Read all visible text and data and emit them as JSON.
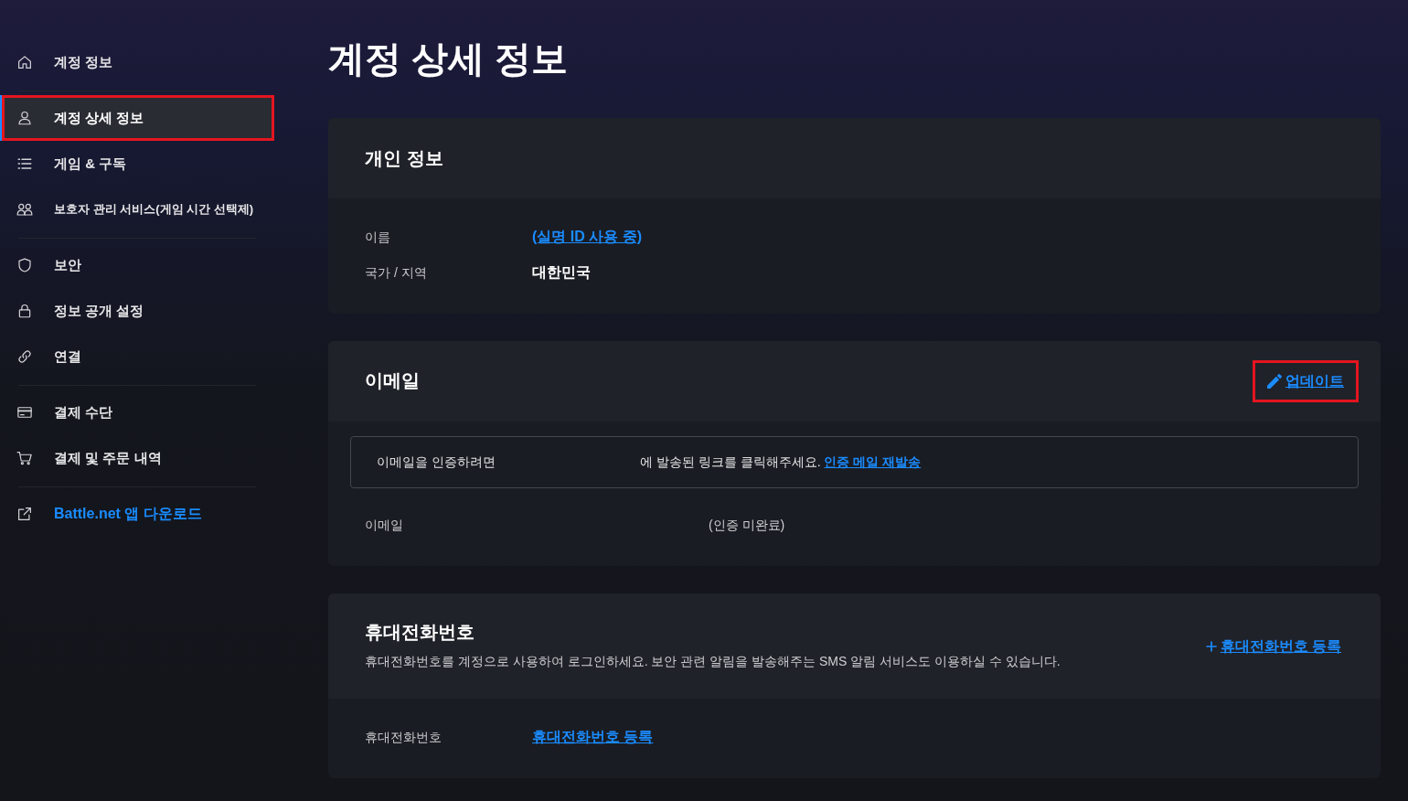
{
  "sidebar": {
    "groups": [
      {
        "items": [
          {
            "label": "계정 정보",
            "kind": "page",
            "selected": false,
            "highlighted": false
          }
        ]
      },
      {
        "items": [
          {
            "label": "계정 상세 정보",
            "kind": "page",
            "selected": true,
            "highlighted": true
          },
          {
            "label": "게임 & 구독",
            "kind": "page",
            "selected": false,
            "highlighted": false
          },
          {
            "label": "보호자 관리 서비스(게임 시간 선택제)",
            "kind": "compact",
            "selected": false,
            "highlighted": false
          }
        ]
      },
      {
        "items": [
          {
            "label": "보안",
            "kind": "page",
            "selected": false,
            "highlighted": false
          },
          {
            "label": "정보 공개 설정",
            "kind": "page",
            "selected": false,
            "highlighted": false
          },
          {
            "label": "연결",
            "kind": "page",
            "selected": false,
            "highlighted": false
          }
        ]
      },
      {
        "items": [
          {
            "label": "결제 수단",
            "kind": "page",
            "selected": false,
            "highlighted": false
          },
          {
            "label": "결제 및 주문 내역",
            "kind": "page",
            "selected": false,
            "highlighted": false
          }
        ]
      },
      {
        "items": [
          {
            "label": "Battle.net 앱 다운로드",
            "kind": "external",
            "selected": false,
            "highlighted": false
          }
        ]
      }
    ]
  },
  "page_title": "계정 상세 정보",
  "sections": [
    {
      "title": "개인 정보",
      "rows": [
        {
          "label": "이름",
          "kind": "link",
          "value": "(실명 ID 사용 중)"
        },
        {
          "label": "국가 / 지역",
          "kind": "text",
          "value": "대한민국"
        }
      ]
    },
    {
      "title": "이메일",
      "action": {
        "label": "업데이트",
        "kind": "edit",
        "highlighted": true
      },
      "notice": {
        "lead": "이메일을 인증하려면",
        "text": "에 발송된 링크를 클릭해주세요.",
        "link": "인증 메일 재발송"
      },
      "rows": [
        {
          "label": "이메일",
          "kind": "status",
          "value": "(인증 미완료)"
        }
      ]
    },
    {
      "title": "휴대전화번호",
      "description": "휴대전화번호를 계정으로 사용하여 로그인하세요. 보안 관련 알림을 발송해주는 SMS 알림 서비스도 이용하실 수 있습니다.",
      "action": {
        "label": "휴대전화번호 등록",
        "kind": "add",
        "highlighted": false
      },
      "rows": [
        {
          "label": "휴대전화번호",
          "kind": "link",
          "value": "휴대전화번호 등록"
        }
      ]
    }
  ]
}
